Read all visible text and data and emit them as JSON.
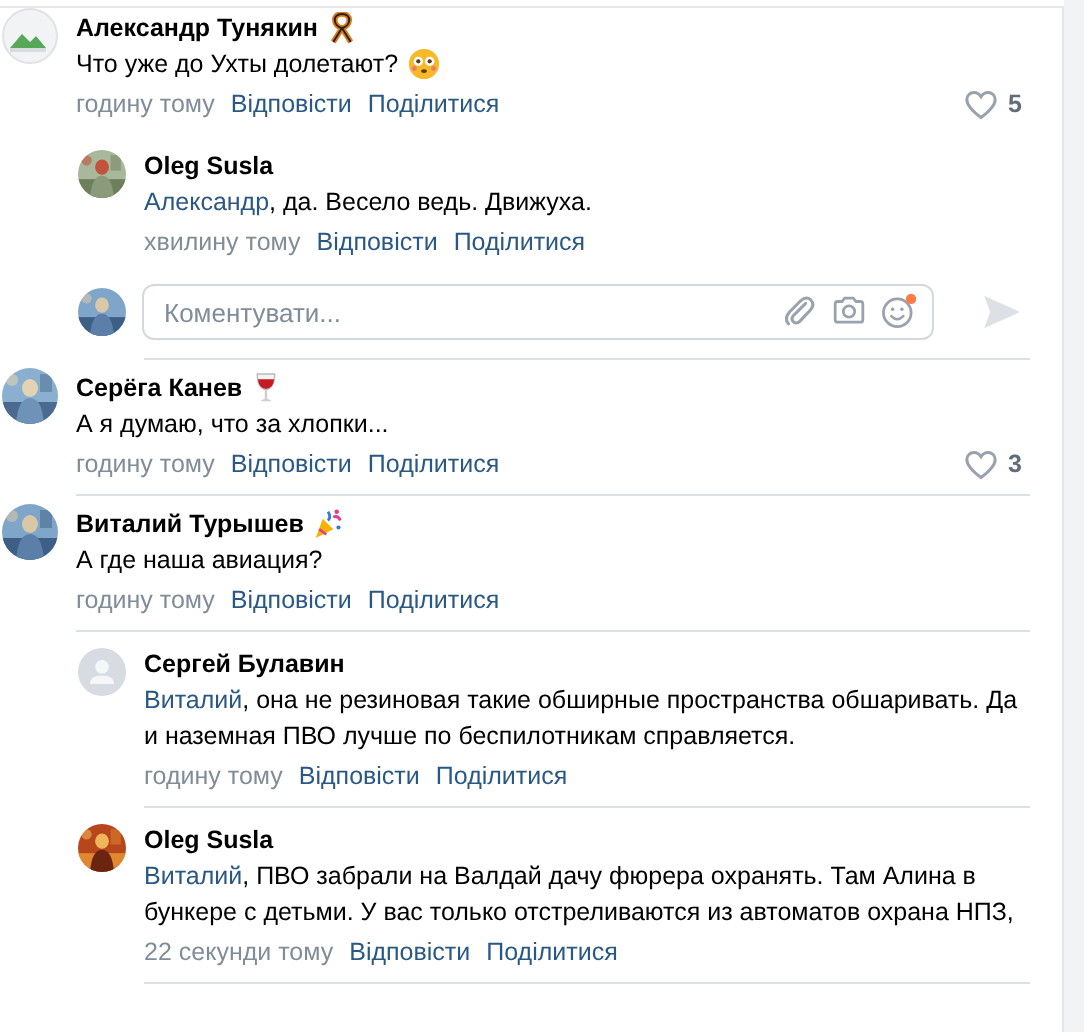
{
  "threads": [
    {
      "comment": {
        "author": "Александр Тунякин",
        "name_icon": {
          "kind": "ribbon"
        },
        "avatar": {
          "kind": "image-placeholder"
        },
        "text": "Что уже до Ухты долетают?",
        "text_icon": {
          "kind": "flushed"
        },
        "time": "годину тому",
        "reply_label": "Відповісти",
        "share_label": "Поділитися",
        "likes": "5",
        "liked": false
      },
      "replies": [
        {
          "author": "Oleg Susla",
          "mention": "Александр",
          "text": ", да. Весело ведь. Движуха.",
          "time": "хвилину тому",
          "reply_label": "Відповісти",
          "share_label": "Поділитися"
        }
      ],
      "composer": {
        "placeholder": "Коментувати...",
        "emoji_badge": true
      }
    },
    {
      "comment": {
        "author": "Серёга Канев",
        "name_icon": {
          "kind": "wine"
        },
        "text": "А я думаю, что за хлопки...",
        "time": "годину тому",
        "reply_label": "Відповісти",
        "share_label": "Поділитися",
        "likes": "3",
        "liked": false
      }
    },
    {
      "comment": {
        "author": "Виталий Турышев",
        "name_icon": {
          "kind": "party"
        },
        "text": "А где наша авиация?",
        "time": "годину тому",
        "reply_label": "Відповісти",
        "share_label": "Поділитися"
      },
      "replies": [
        {
          "author": "Сергей Булавин",
          "avatar": {
            "kind": "person-placeholder"
          },
          "mention": "Виталий",
          "text": ", она не резиновая такие обширные пространства обшаривать. Да и наземная ПВО лучше по беспилотникам справляется.",
          "time": "годину тому",
          "reply_label": "Відповісти",
          "share_label": "Поділитися"
        },
        {
          "author": "Oleg Susla",
          "mention": "Виталий",
          "text": ", ПВО забрали на Валдай дачу фюрера охранять. Там Алина в бункере с детьми. У вас только отстреливаются из автоматов охрана НПЗ,",
          "time": "22 секунди тому",
          "reply_label": "Відповісти",
          "share_label": "Поділитися"
        }
      ]
    }
  ]
}
